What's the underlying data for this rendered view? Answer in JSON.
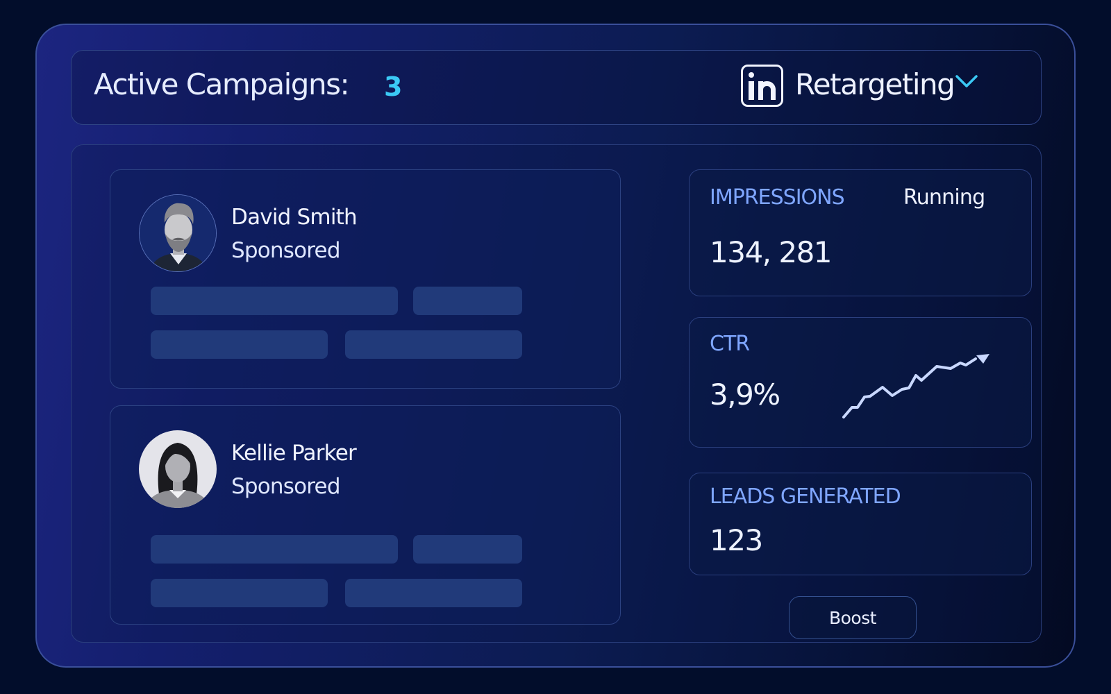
{
  "header": {
    "title": "Active Campaigns:",
    "count": "3",
    "platform_icon": "linkedin-icon",
    "dropdown_label": "Retargeting",
    "dropdown_icon": "chevron-down-icon"
  },
  "ads": [
    {
      "name": "David Smith",
      "label": "Sponsored",
      "avatar": "bearded-man-avatar"
    },
    {
      "name": "Kellie Parker",
      "label": "Sponsored",
      "avatar": "woman-avatar"
    }
  ],
  "stats": {
    "impressions": {
      "label": "IMPRESSIONS",
      "status": "Running",
      "value": "134, 281"
    },
    "ctr": {
      "label": "CTR",
      "value": "3,9%",
      "trend_icon": "trend-up-arrow-icon"
    },
    "leads": {
      "label": "LEADS GENERATED",
      "value": "123"
    }
  },
  "boost_button": "Boost",
  "colors": {
    "accent_count": "#3bc9f5",
    "stat_label": "#7fa6ff",
    "placeholder_bar": "#213a7a"
  }
}
